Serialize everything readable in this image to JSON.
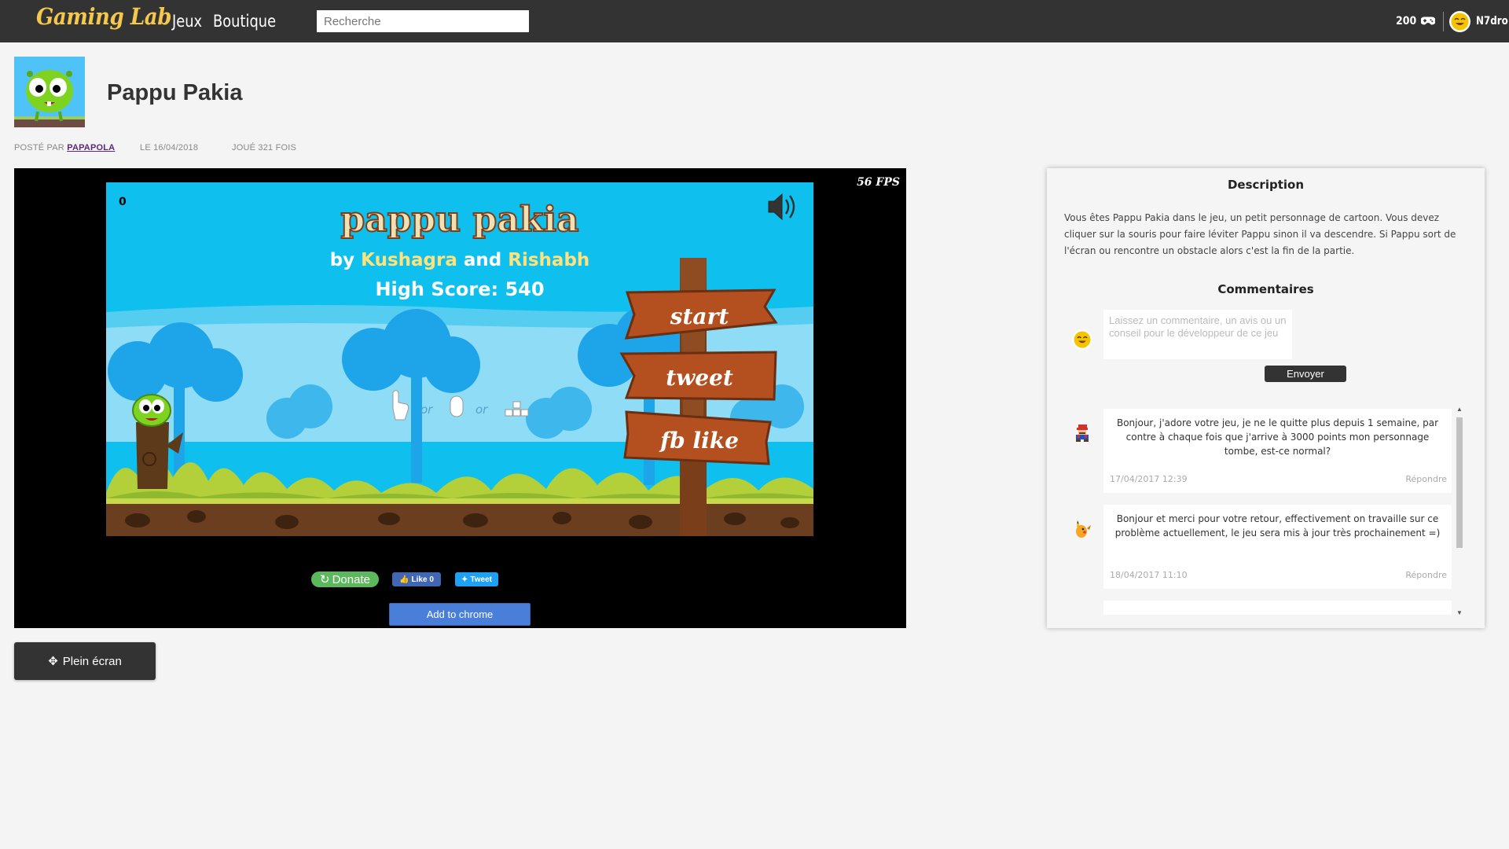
{
  "navbar": {
    "logo": "Gaming Lab",
    "links": [
      "Jeux",
      "Boutique"
    ],
    "search_placeholder": "Recherche",
    "credits": "200",
    "credits_icon": "gamepad-icon",
    "username": "N7dro"
  },
  "game": {
    "title": "Pappu Pakia",
    "posted_label": "Posté par",
    "author": "PAPAPOLA",
    "date": "Le 16/04/2018",
    "plays": "Joué 321 fois",
    "fps": "56 FPS",
    "screen": {
      "score_counter": "0",
      "title": "pappu pakia",
      "by_prefix": "by ",
      "author1": "Kushagra",
      "and_word": " and ",
      "author2": "Rishabh",
      "high_score": "High Score: 540",
      "sign_start": "start",
      "sign_tweet": "tweet",
      "sign_fblike": "fb like",
      "controls_or_1": "or",
      "controls_or_2": "or"
    },
    "buttons": {
      "donate": "Donate",
      "fb_like": "Like 0",
      "tweet": "Tweet",
      "add_to_chrome": "Add to chrome"
    },
    "fullscreen": "Plein écran"
  },
  "panel": {
    "description_title": "Description",
    "description": "Vous êtes Pappu Pakia dans le jeu, un petit personnage de cartoon. Vous devez cliquer sur la souris pour faire léviter Pappu sinon il va descendre. Si Pappu sort de l'écran ou rencontre un obstacle alors c'est la fin de la partie.",
    "comments_title": "Commentaires",
    "comment_placeholder": "Laissez un commentaire, un avis ou un conseil pour le développeur de ce jeu",
    "send": "Envoyer",
    "comments": [
      {
        "avatar": "mario-avatar",
        "text": "Bonjour, j'adore votre jeu, je ne le quitte plus depuis 1 semaine, par contre à chaque fois que j'arrive à 3000 points mon personnage tombe, est-ce normal?",
        "date": "17/04/2017 12:39",
        "reply": "Répondre"
      },
      {
        "avatar": "pikachu-avatar",
        "text": "Bonjour et merci pour votre retour, effectivement on travaille sur ce problème actuellement, le jeu sera mis à jour très prochainement =)",
        "date": "18/04/2017 11:10",
        "reply": "Répondre"
      }
    ]
  },
  "colors": {
    "navbar": "#333333",
    "logo": "#f5c84c",
    "sky": "#0fc0ef",
    "sign_wood": "#b4501f",
    "donate": "#5cb85c",
    "chrome_button": "#4a7fd9"
  }
}
